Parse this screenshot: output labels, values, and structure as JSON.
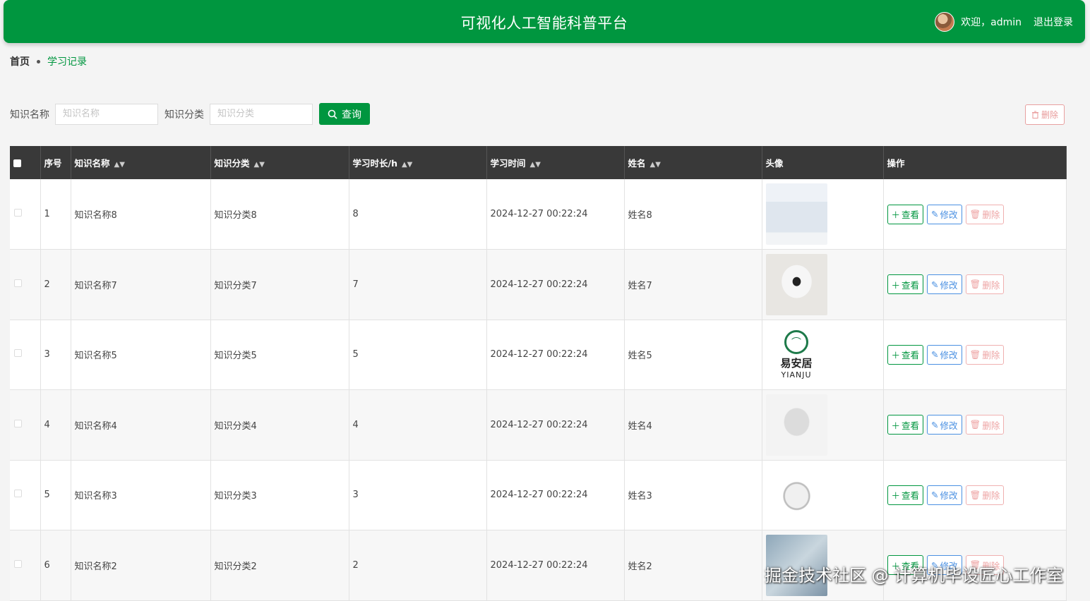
{
  "header": {
    "title": "可视化人工智能科普平台",
    "welcome": "欢迎，admin",
    "logout": "退出登录"
  },
  "breadcrumb": {
    "home": "首页",
    "current": "学习记录"
  },
  "search": {
    "name_label": "知识名称",
    "name_placeholder": "知识名称",
    "category_label": "知识分类",
    "category_placeholder": "知识分类",
    "query_button": "查询"
  },
  "bulk_delete": "删除",
  "table": {
    "columns": [
      "序号",
      "知识名称",
      "知识分类",
      "学习时长/h",
      "学习时间",
      "姓名",
      "头像",
      "操作"
    ],
    "rows": [
      {
        "index": "1",
        "name": "知识名称8",
        "category": "知识分类8",
        "hours": "8",
        "time": "2024-12-27 00:22:24",
        "person": "姓名8",
        "avatar": "product-poster"
      },
      {
        "index": "2",
        "name": "知识名称7",
        "category": "知识分类7",
        "hours": "7",
        "time": "2024-12-27 00:22:24",
        "person": "姓名7",
        "avatar": "security-camera"
      },
      {
        "index": "3",
        "name": "知识名称5",
        "category": "知识分类5",
        "hours": "5",
        "time": "2024-12-27 00:22:24",
        "person": "姓名5",
        "avatar": "yianju-logo"
      },
      {
        "index": "4",
        "name": "知识名称4",
        "category": "知识分类4",
        "hours": "4",
        "time": "2024-12-27 00:22:24",
        "person": "姓名4",
        "avatar": "robot-device"
      },
      {
        "index": "5",
        "name": "知识名称3",
        "category": "知识分类3",
        "hours": "3",
        "time": "2024-12-27 00:22:24",
        "person": "姓名3",
        "avatar": "window-cleaning-robot"
      },
      {
        "index": "6",
        "name": "知识名称2",
        "category": "知识分类2",
        "hours": "2",
        "time": "2024-12-27 00:22:24",
        "person": "姓名2",
        "avatar": "smart-home-scene"
      }
    ],
    "actions": {
      "view": "查看",
      "edit": "修改",
      "delete": "删除"
    }
  },
  "logo": {
    "name": "易安居",
    "sub": "YIANJU"
  },
  "watermark": "掘金技术社区 @ 计算机毕设匠心工作室",
  "colors": {
    "brand": "#00963f",
    "header_bg": "#393939",
    "danger": "#e89a9a",
    "edit": "#4a90e2"
  }
}
